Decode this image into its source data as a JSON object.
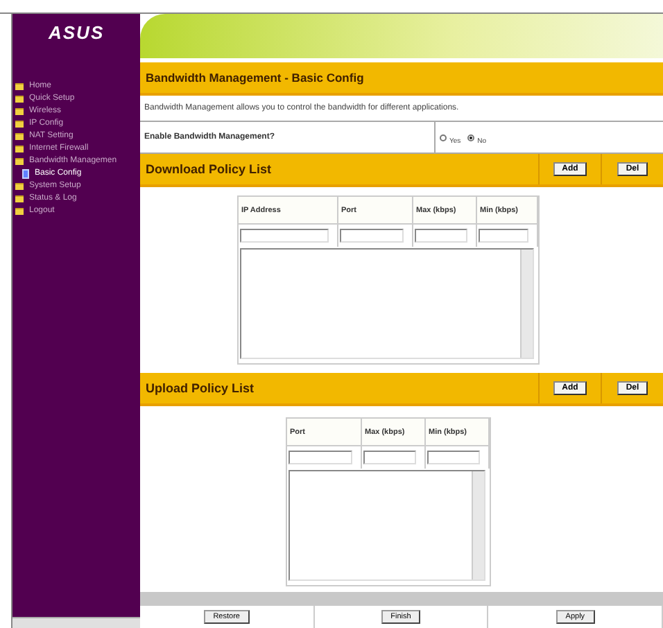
{
  "sidebar": {
    "logo": "ASUS",
    "items": [
      {
        "label": "Home",
        "selected": false
      },
      {
        "label": "Quick Setup",
        "selected": false
      },
      {
        "label": "Wireless",
        "selected": false
      },
      {
        "label": "IP Config",
        "selected": false
      },
      {
        "label": "NAT Setting",
        "selected": false
      },
      {
        "label": "Internet Firewall",
        "selected": false
      },
      {
        "label": "Bandwidth Managemen",
        "selected": false,
        "children": [
          {
            "label": "Basic Config",
            "selected": true
          }
        ]
      },
      {
        "label": "System Setup",
        "selected": false
      },
      {
        "label": "Status & Log",
        "selected": false
      },
      {
        "label": "Logout",
        "selected": false
      }
    ]
  },
  "page": {
    "title": "Bandwidth Management - Basic Config",
    "description": "Bandwidth Management allows you to control the bandwidth for different applications.",
    "enable": {
      "label": "Enable Bandwidth Management?",
      "options": [
        {
          "label": "Yes",
          "selected": false
        },
        {
          "label": "No",
          "selected": true
        }
      ]
    }
  },
  "download": {
    "title": "Download Policy List",
    "buttons": [
      "Add",
      "Del"
    ],
    "columns": [
      "IP Address",
      "Port",
      "Max (kbps)",
      "Min (kbps)"
    ]
  },
  "upload": {
    "title": "Upload Policy List",
    "buttons": [
      "Add",
      "Del"
    ],
    "columns": [
      "Port",
      "Max (kbps)",
      "Min (kbps)"
    ]
  },
  "footer_buttons": [
    "Restore",
    "Finish",
    "Apply"
  ]
}
